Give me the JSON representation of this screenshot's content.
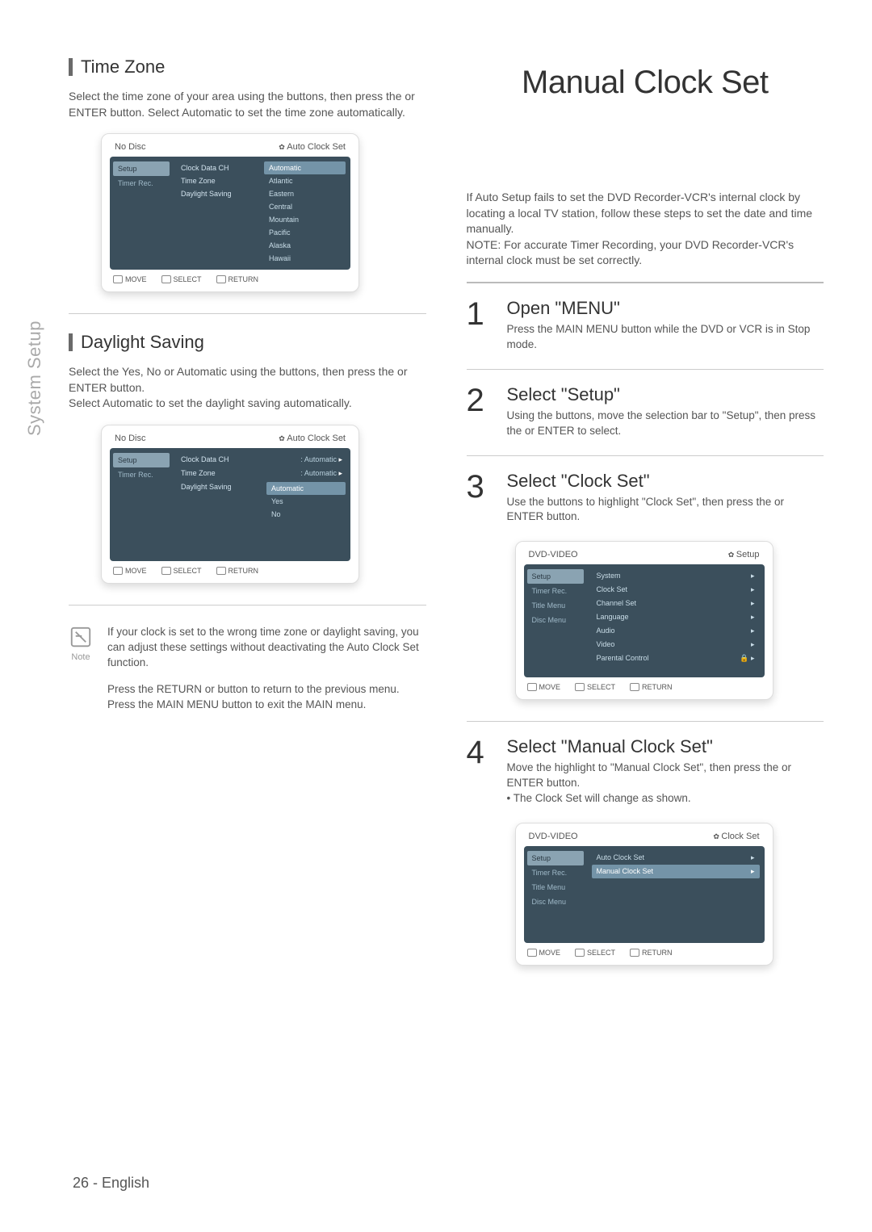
{
  "sideTab": "System Setup",
  "left": {
    "timeZone": {
      "title": "Time Zone",
      "para": "Select the time zone of your area using the          buttons, then press the       or ENTER button. Select Automatic to set the time zone automatically."
    },
    "daylight": {
      "title": "Daylight Saving",
      "para": "Select the Yes, No or Automatic using the          buttons, then press the       or ENTER button.\nSelect Automatic to set the daylight saving automatically."
    },
    "noteLabel": "Note",
    "noteP1": "If your clock is set to the wrong time zone or daylight saving, you can adjust these settings without deactivating the Auto Clock Set function.",
    "noteP2": "Press the RETURN or        button to return to the previous menu. Press the MAIN MENU button to exit the MAIN menu."
  },
  "osd1": {
    "topLeft": "No Disc",
    "topRight": "Auto Clock Set",
    "side": [
      "Setup",
      "Timer Rec."
    ],
    "rows": [
      "Clock Data CH",
      "Time Zone",
      "Daylight Saving"
    ],
    "options": [
      "Automatic",
      "Atlantic",
      "Eastern",
      "Central",
      "Mountain",
      "Pacific",
      "Alaska",
      "Hawaii"
    ],
    "foot": [
      "MOVE",
      "SELECT",
      "RETURN"
    ]
  },
  "osd2": {
    "topLeft": "No Disc",
    "topRight": "Auto Clock Set",
    "side": [
      "Setup",
      "Timer Rec."
    ],
    "rows": [
      {
        "k": "Clock Data CH",
        "v": ": Automatic"
      },
      {
        "k": "Time Zone",
        "v": ": Automatic"
      },
      {
        "k": "Daylight Saving",
        "v": ""
      }
    ],
    "options": [
      "Automatic",
      "Yes",
      "No"
    ],
    "foot": [
      "MOVE",
      "SELECT",
      "RETURN"
    ]
  },
  "right": {
    "title": "Manual Clock Set",
    "intro": "If Auto Setup fails to set the DVD Recorder-VCR's internal clock by locating a local TV station, follow these steps to set the date and time manually.\nNOTE: For accurate Timer Recording, your DVD Recorder-VCR's internal clock must be set correctly.",
    "steps": [
      {
        "n": "1",
        "t": "Open \"MENU\"",
        "d": "Press the MAIN MENU button while the DVD or VCR is in Stop mode."
      },
      {
        "n": "2",
        "t": "Select \"Setup\"",
        "d": "Using the          buttons, move the selection bar to \"Setup\", then press the       or ENTER to select."
      },
      {
        "n": "3",
        "t": "Select \"Clock Set\"",
        "d": "Use the          buttons to highlight \"Clock Set\", then press the       or ENTER button."
      },
      {
        "n": "4",
        "t": "Select \"Manual Clock Set\"",
        "d": "Move the highlight to \"Manual Clock Set\", then press the       or ENTER button.\n• The Clock Set will change as shown."
      }
    ]
  },
  "osd3": {
    "topLeft": "DVD-VIDEO",
    "topRight": "Setup",
    "side": [
      "Setup",
      "Timer Rec.",
      "Title Menu",
      "Disc Menu"
    ],
    "rows": [
      "System",
      "Clock Set",
      "Channel Set",
      "Language",
      "Audio",
      "Video",
      "Parental Control"
    ],
    "foot": [
      "MOVE",
      "SELECT",
      "RETURN"
    ]
  },
  "osd4": {
    "topLeft": "DVD-VIDEO",
    "topRight": "Clock Set",
    "side": [
      "Setup",
      "Timer Rec.",
      "Title Menu",
      "Disc Menu"
    ],
    "rows": [
      "Auto Clock Set",
      "Manual Clock Set"
    ],
    "foot": [
      "MOVE",
      "SELECT",
      "RETURN"
    ]
  },
  "pageFooter": "26 - English"
}
